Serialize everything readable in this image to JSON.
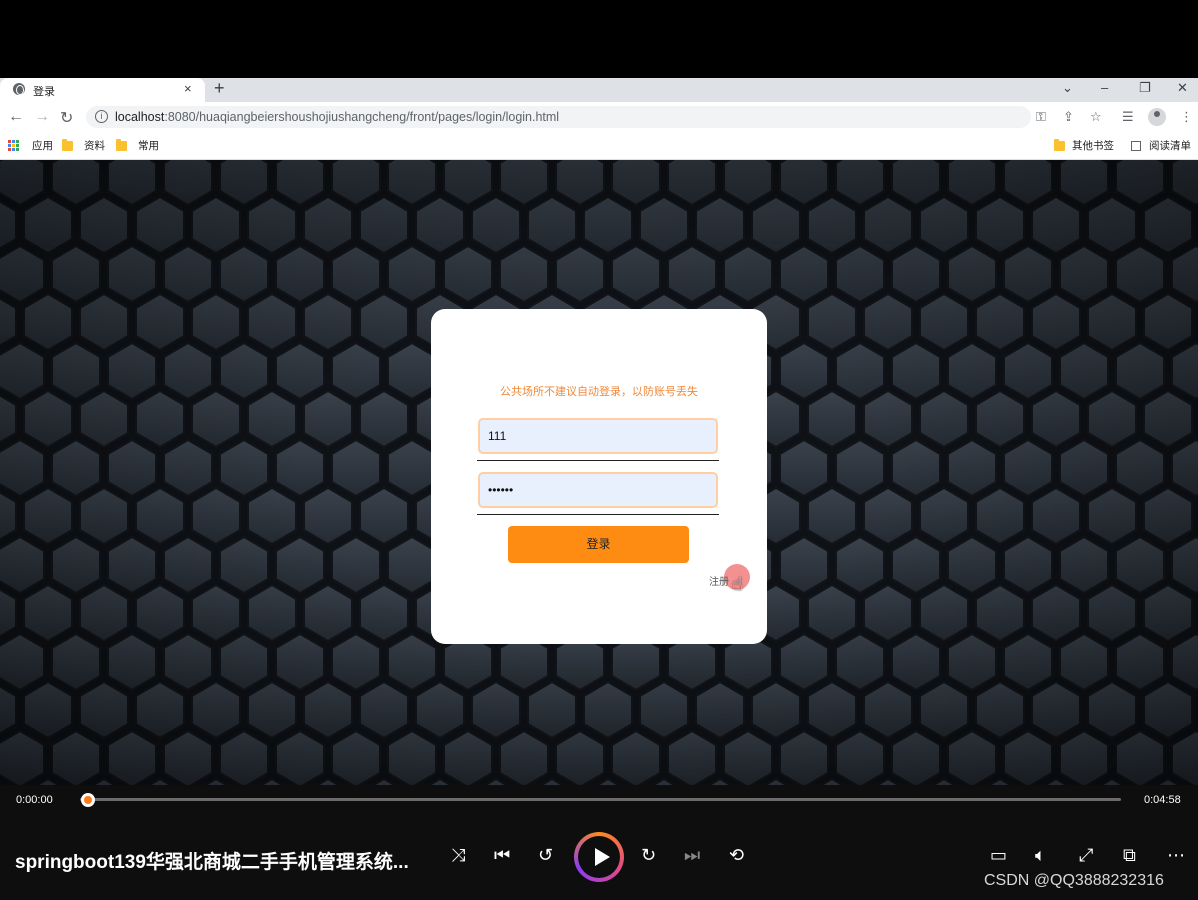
{
  "browser": {
    "tab_title": "登录",
    "tab_close": "×",
    "new_tab": "+",
    "url_host": "localhost",
    "url_path": ":8080/huaqiangbeiershoushojiushangcheng/front/pages/login/login.html",
    "window_controls": {
      "dropdown": "⌄",
      "minimize": "–",
      "restore": "❐",
      "close": "✕"
    }
  },
  "bookmarks": {
    "apps": "应用",
    "items": [
      "资料",
      "常用"
    ],
    "other": "其他书签",
    "reading_list": "阅读清单"
  },
  "login": {
    "warning": "公共场所不建议自动登录，以防账号丢失",
    "username_value": "111",
    "password_value": "••••••",
    "login_button": "登录",
    "register_link": "注册"
  },
  "player": {
    "current_time": "0:00:00",
    "duration": "0:04:58",
    "progress": 0.0,
    "video_title": "springboot139华强北商城二手手机管理系统...",
    "watermark": "CSDN @QQ3888232316"
  },
  "colors": {
    "accent": "#ff8c12",
    "warning_text": "#f0883a",
    "page_bg": "#1f252c"
  }
}
